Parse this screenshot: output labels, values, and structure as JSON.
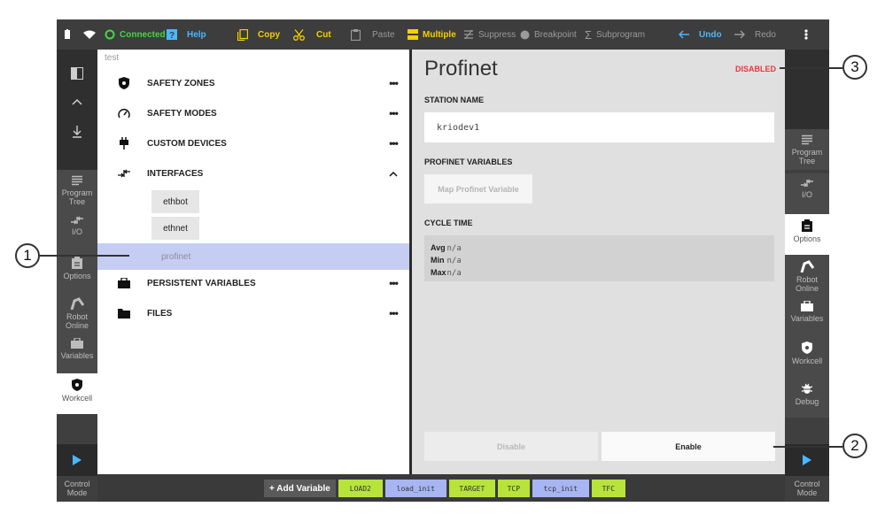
{
  "toolbar": {
    "connected": "Connected",
    "help": "Help",
    "copy": "Copy",
    "cut": "Cut",
    "paste": "Paste",
    "multiple": "Multiple",
    "suppress": "Suppress",
    "breakpoint": "Breakpoint",
    "subprogram": "Subprogram",
    "undo": "Undo",
    "redo": "Redo"
  },
  "left_nav": {
    "items": [
      {
        "label": "Program Tree",
        "icon": "list-icon"
      },
      {
        "label": "I/O",
        "icon": "io-arrows-icon"
      },
      {
        "label": "Options",
        "icon": "clipboard-icon"
      },
      {
        "label": "Robot Online",
        "icon": "robot-arm-icon"
      },
      {
        "label": "Variables",
        "icon": "briefcase-icon"
      },
      {
        "label": "Workcell",
        "icon": "shield-icon"
      }
    ],
    "control_mode": "Control Mode"
  },
  "right_nav": {
    "items": [
      {
        "label": "Program Tree"
      },
      {
        "label": "I/O"
      },
      {
        "label": "Options"
      },
      {
        "label": "Robot Online"
      },
      {
        "label": "Variables"
      },
      {
        "label": "Workcell"
      },
      {
        "label": "Debug"
      }
    ],
    "control_mode": "Control Mode"
  },
  "tree": {
    "header": "test",
    "items": [
      {
        "label": "SAFETY ZONES",
        "icon": "shield-icon"
      },
      {
        "label": "SAFETY MODES",
        "icon": "gauge-icon"
      },
      {
        "label": "CUSTOM DEVICES",
        "icon": "plug-icon"
      },
      {
        "label": "INTERFACES",
        "icon": "io-arrows-icon"
      },
      {
        "label": "PERSISTENT VARIABLES",
        "icon": "briefcase-icon"
      },
      {
        "label": "FILES",
        "icon": "folder-icon"
      }
    ],
    "interfaces": [
      "ethbot",
      "ethnet",
      "profinet"
    ],
    "more": "•••"
  },
  "detail": {
    "title": "Profinet",
    "status": "DISABLED",
    "station_name_label": "STATION NAME",
    "station_name_value": "kriodev1",
    "variables_label": "PROFINET VARIABLES",
    "map_button": "Map Profinet Variable",
    "cycle_label": "CYCLE TIME",
    "cycle": {
      "avg_label": "Avg",
      "avg": "n/a",
      "min_label": "Min",
      "min": "n/a",
      "max_label": "Max",
      "max": "n/a"
    },
    "disable_button": "Disable",
    "enable_button": "Enable"
  },
  "bottom": {
    "add_variable": "+ Add Variable",
    "chips": [
      "LOAD2",
      "load_init",
      "TARGET",
      "TCP",
      "tcp_init",
      "TFC"
    ]
  },
  "callouts": [
    "1",
    "2",
    "3"
  ],
  "colors": {
    "connected": "#3fd93f",
    "accent_blue": "#49b8ff",
    "accent_yellow": "#f5d000",
    "status_red": "#e23b3b",
    "selection": "#c5cef2",
    "chip_green": "#b7e33b",
    "chip_purple": "#a7b5f2"
  }
}
